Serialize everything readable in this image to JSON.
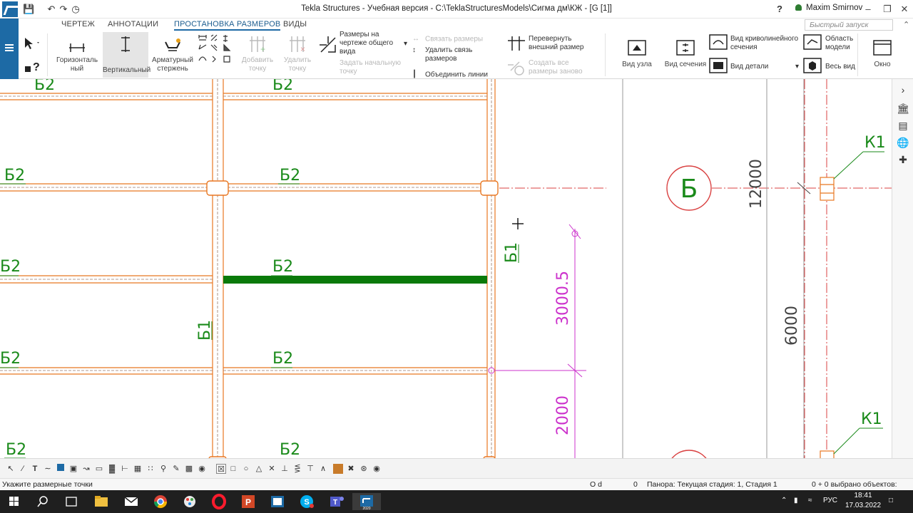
{
  "window": {
    "title": "Tekla Structures - Учебная версия - C:\\TeklaStructuresModels\\Сигма дм\\КЖ - [G   [1]]",
    "user": "Maxim Smirnov",
    "quick_launch_placeholder": "Быстрый запуск"
  },
  "tabs": [
    "ЧЕРТЕЖ",
    "АННОТАЦИИ",
    "ПРОСТАНОВКА РАЗМЕРОВ",
    "ВИДЫ"
  ],
  "ribbon": {
    "horizontal": "Горизонталь ный",
    "vertical": "Вертикальный",
    "rebar": "Арматурный стержень",
    "add_point": "Добавить точку",
    "delete_point": "Удалить точку",
    "general_dims": "Размеры на чертеже общего вида",
    "link_dims": "Связать размеры",
    "unlink_dims": "Удалить связь размеров",
    "set_start": "Задать начальную точку",
    "merge_lines": "Объединить линии",
    "flip_external": "Перевернуть внешний размер",
    "recreate_dims": "Создать все размеры заново",
    "node_view": "Вид узла",
    "section_view": "Вид сечения",
    "curved_section": "Вид криволинейного сечения",
    "detail_view": "Вид детали",
    "model_area": "Область модели",
    "whole_view": "Весь вид",
    "window": "Окно"
  },
  "drawing": {
    "labels": {
      "b2": "Б2",
      "b1": "Б1",
      "k1": "К1",
      "axis_b": "Б",
      "dim_3000": "3000.5",
      "dim_2000": "2000",
      "dim_12000": "12000",
      "dim_6000": "6000"
    },
    "colors": {
      "beam": "#e87722",
      "label": "#1a8a1a",
      "selected": "#0a7a0a",
      "dimension": "#cc33cc",
      "axis": "#d94040",
      "dark_dim": "#444444"
    }
  },
  "status": {
    "prompt": "Укажите размерные точки",
    "od": "O d",
    "zero": "0",
    "stage": "Панора: Текущая стадия: 1, Стадия 1",
    "selected": "0 + 0 выбрано объектов:"
  },
  "taskbar": {
    "lang": "РУС",
    "time": "18:41",
    "date": "17.03.2022"
  }
}
